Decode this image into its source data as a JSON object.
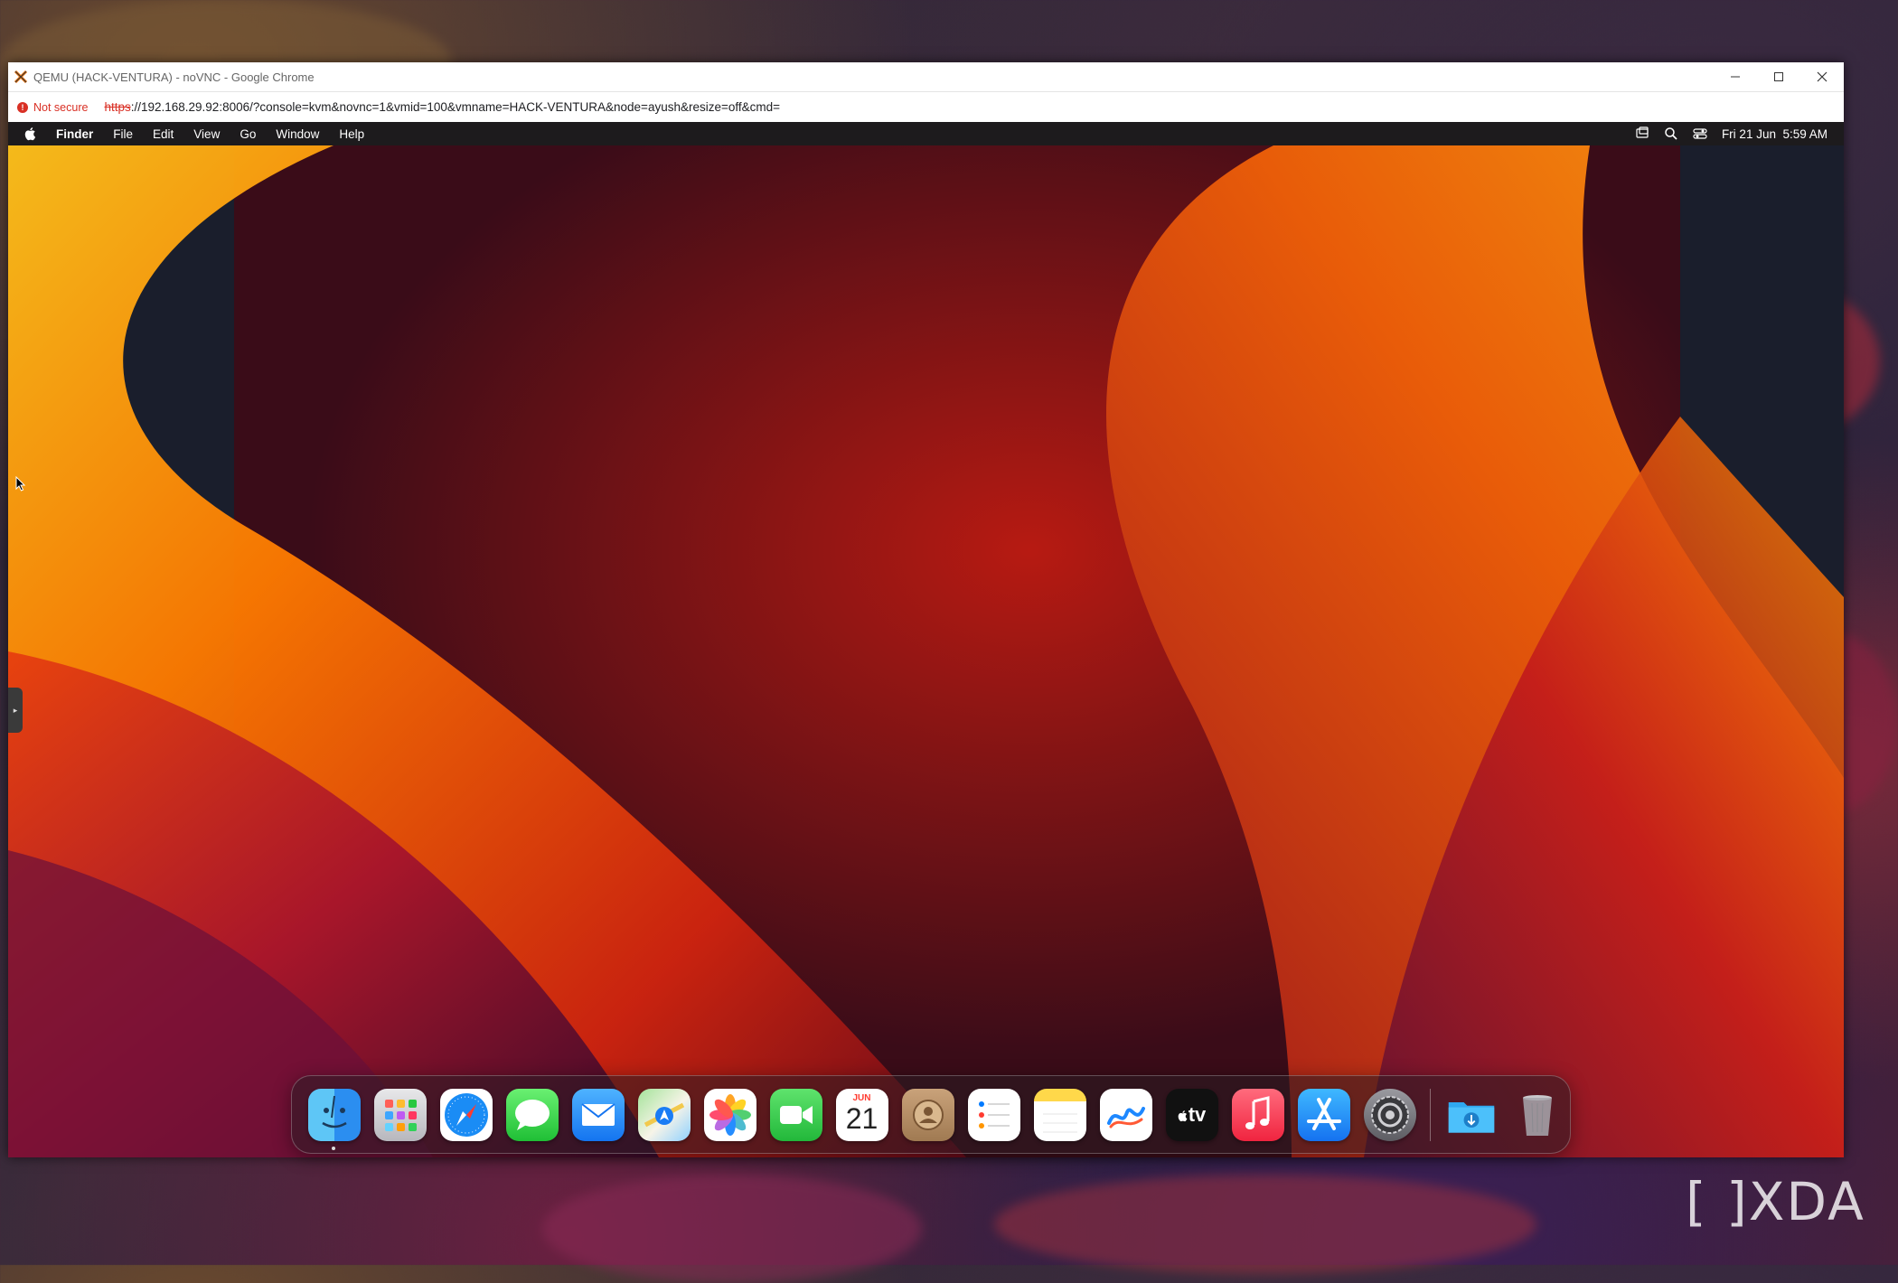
{
  "browser": {
    "title": "QEMU (HACK-VENTURA) - noVNC - Google Chrome",
    "not_secure_label": "Not secure",
    "url_scheme": "https",
    "url_rest": "://192.168.29.92:8006/?console=kvm&novnc=1&vmid=100&vmname=HACK-VENTURA&node=ayush&resize=off&cmd=",
    "controls": [
      "minimize",
      "maximize",
      "close"
    ]
  },
  "mac_menubar": {
    "app_name": "Finder",
    "menus": [
      "File",
      "Edit",
      "View",
      "Go",
      "Window",
      "Help"
    ],
    "datetime": "Fri 21 Jun  5:59 AM",
    "status_icons": [
      "screen-mirroring-icon",
      "spotlight-search-icon",
      "control-center-icon"
    ]
  },
  "dock": {
    "apps": [
      {
        "name": "Finder",
        "icon": "finder-icon",
        "running": true
      },
      {
        "name": "Launchpad",
        "icon": "launchpad-icon"
      },
      {
        "name": "Safari",
        "icon": "safari-icon"
      },
      {
        "name": "Messages",
        "icon": "messages-icon"
      },
      {
        "name": "Mail",
        "icon": "mail-icon"
      },
      {
        "name": "Maps",
        "icon": "maps-icon"
      },
      {
        "name": "Photos",
        "icon": "photos-icon"
      },
      {
        "name": "FaceTime",
        "icon": "facetime-icon"
      },
      {
        "name": "Calendar",
        "icon": "calendar-icon",
        "month": "JUN",
        "day": "21"
      },
      {
        "name": "Contacts",
        "icon": "contacts-icon"
      },
      {
        "name": "Reminders",
        "icon": "reminders-icon"
      },
      {
        "name": "Notes",
        "icon": "notes-icon"
      },
      {
        "name": "Freeform",
        "icon": "freeform-icon"
      },
      {
        "name": "TV",
        "icon": "apple-tv-icon",
        "label": "tv"
      },
      {
        "name": "Music",
        "icon": "music-icon"
      },
      {
        "name": "App Store",
        "icon": "app-store-icon"
      },
      {
        "name": "System Settings",
        "icon": "system-settings-icon"
      }
    ],
    "extras": [
      {
        "name": "Downloads",
        "icon": "downloads-folder-icon"
      },
      {
        "name": "Trash",
        "icon": "trash-icon"
      }
    ]
  },
  "watermark": "[ ]XDA",
  "colors": {
    "menubar_bg": "#1d1b1d",
    "not_secure": "#d93025",
    "wallpaper_orange": "#ff8a00",
    "wallpaper_red": "#c0161c"
  }
}
